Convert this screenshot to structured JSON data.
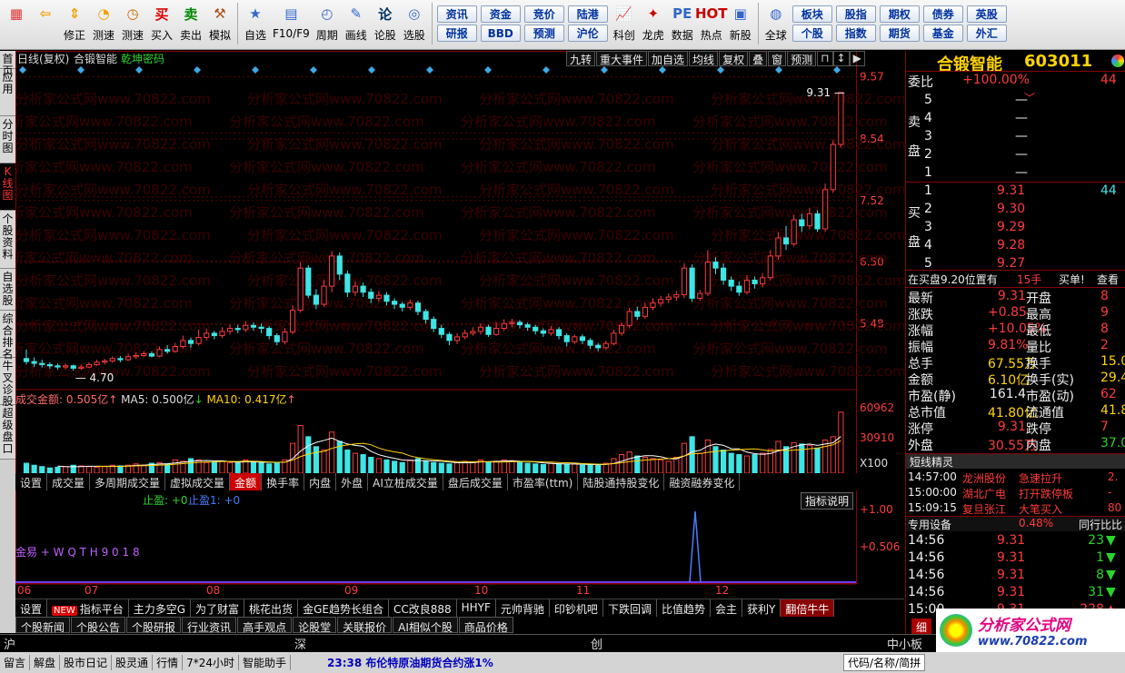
{
  "toolbar": {
    "buttons": [
      {
        "label": "",
        "icon": "grid-icon"
      },
      {
        "label": "",
        "icon": "back-arrow-icon"
      },
      {
        "label": "修正",
        "icon": "up-down-arrows-icon"
      },
      {
        "label": "测速",
        "icon": "speed-icon"
      },
      {
        "label": "测速",
        "icon": "clock-icon"
      },
      {
        "label": "买入",
        "icon": "buy-icon",
        "glyph": "买"
      },
      {
        "label": "卖出",
        "icon": "sell-icon",
        "glyph": "卖"
      },
      {
        "label": "模拟",
        "icon": "hammer-icon"
      },
      {
        "label": "自选",
        "icon": "star-icon"
      },
      {
        "label": "F10/F9",
        "icon": "f10-icon"
      },
      {
        "label": "周期",
        "icon": "period-icon"
      },
      {
        "label": "画线",
        "icon": "pencil-icon"
      },
      {
        "label": "论股",
        "icon": "comment-icon",
        "glyph": "论"
      },
      {
        "label": "选股",
        "icon": "select-stock-icon"
      },
      {
        "label": "科创",
        "icon": "chart-icon"
      },
      {
        "label": "龙虎",
        "icon": "dragon-icon"
      },
      {
        "label": "数据",
        "icon": "pe-icon",
        "glyph": "PE"
      },
      {
        "label": "热点",
        "icon": "hot-icon",
        "glyph": "HOT"
      },
      {
        "label": "新股",
        "icon": "new-stock-icon"
      },
      {
        "label": "全球",
        "icon": "globe-icon"
      }
    ],
    "quick_grid1": [
      [
        "资讯",
        "研报"
      ],
      [
        "资金",
        "BBD"
      ],
      [
        "竞价",
        "预测"
      ],
      [
        "陆港",
        "沪伦"
      ]
    ],
    "quick_grid2": [
      [
        "板块",
        "个股"
      ],
      [
        "股指",
        "指数"
      ],
      [
        "期权",
        "期货"
      ],
      [
        "债券",
        "基金"
      ],
      [
        "英股",
        "外汇"
      ]
    ]
  },
  "left_tabs": [
    "首页",
    "应用",
    "分时图",
    "K线图",
    "个股资料",
    "自选股",
    "综合排名",
    "牛叉诊股",
    "超级盘口"
  ],
  "chart_header": {
    "mode": "日线(复权)",
    "stock_name": "合锻智能",
    "secret": "乾坤密码",
    "buttons": [
      "九转",
      "重大事件",
      "加自选",
      "均线",
      "复权",
      "叠",
      "窗",
      "预测"
    ]
  },
  "volume_header": {
    "label": "成交金额:",
    "value": "0.505亿",
    "ma5_label": "MA5:",
    "ma5": "0.500亿",
    "ma10_label": "MA10:",
    "ma10": "0.417亿"
  },
  "indicator_header": {
    "stop1": "止盈: +0",
    "stop2": "止盈1: +0",
    "explain": "指标说明",
    "code": "金易 + W Q T H 9 0 1 8"
  },
  "chart_data": {
    "type": "candlestick",
    "price_axis": [
      "9.57",
      "8.54",
      "7.52",
      "6.50",
      "5.48"
    ],
    "volume_axis": [
      "60962",
      "30910",
      "X100"
    ],
    "indicator_axis": [
      "+1.00",
      "+0.506"
    ],
    "months": [
      "06",
      "07",
      "08",
      "09",
      "10",
      "11",
      "12"
    ],
    "high_label": "9.31",
    "low_label": "4.70",
    "ylim": [
      4.4,
      9.7
    ],
    "candles": [
      [
        4.9,
        4.85,
        5.05,
        4.8
      ],
      [
        4.85,
        4.82,
        4.92,
        4.76
      ],
      [
        4.82,
        4.8,
        4.88,
        4.75
      ],
      [
        4.8,
        4.78,
        4.84,
        4.73
      ],
      [
        4.78,
        4.76,
        4.82,
        4.72
      ],
      [
        4.76,
        4.78,
        4.82,
        4.72
      ],
      [
        4.78,
        4.74,
        4.8,
        4.7
      ],
      [
        4.74,
        4.76,
        4.8,
        4.71
      ],
      [
        4.76,
        4.8,
        4.84,
        4.74
      ],
      [
        4.8,
        4.84,
        4.88,
        4.78
      ],
      [
        4.84,
        4.86,
        4.9,
        4.8
      ],
      [
        4.86,
        4.9,
        4.94,
        4.83
      ],
      [
        4.9,
        4.88,
        4.94,
        4.84
      ],
      [
        4.88,
        4.93,
        4.98,
        4.86
      ],
      [
        4.93,
        4.95,
        5.0,
        4.9
      ],
      [
        4.95,
        4.98,
        5.02,
        4.92
      ],
      [
        4.98,
        4.94,
        5.02,
        4.92
      ],
      [
        4.94,
        5.05,
        5.1,
        4.92
      ],
      [
        5.05,
        5.02,
        5.12,
        4.98
      ],
      [
        5.02,
        5.1,
        5.16,
        5.0
      ],
      [
        5.1,
        5.2,
        5.28,
        5.06
      ],
      [
        5.2,
        5.15,
        5.25,
        5.08
      ],
      [
        5.15,
        5.25,
        5.38,
        5.12
      ],
      [
        5.25,
        5.32,
        5.4,
        5.2
      ],
      [
        5.32,
        5.28,
        5.36,
        5.22
      ],
      [
        5.28,
        5.35,
        5.42,
        5.24
      ],
      [
        5.35,
        5.4,
        5.46,
        5.3
      ],
      [
        5.4,
        5.38,
        5.46,
        5.32
      ],
      [
        5.38,
        5.45,
        5.52,
        5.34
      ],
      [
        5.45,
        5.42,
        5.5,
        5.36
      ],
      [
        5.42,
        5.4,
        5.48,
        5.32
      ],
      [
        5.4,
        5.28,
        5.44,
        5.22
      ],
      [
        5.28,
        5.18,
        5.32,
        5.12
      ],
      [
        5.18,
        5.34,
        5.4,
        5.14
      ],
      [
        5.34,
        5.7,
        5.78,
        5.3
      ],
      [
        5.7,
        6.4,
        6.5,
        5.66
      ],
      [
        6.4,
        5.95,
        6.45,
        5.9
      ],
      [
        5.95,
        5.8,
        6.05,
        5.72
      ],
      [
        5.8,
        6.1,
        6.2,
        5.76
      ],
      [
        6.1,
        6.6,
        6.68,
        6.0
      ],
      [
        6.6,
        6.3,
        6.66,
        6.2
      ],
      [
        6.3,
        6.0,
        6.36,
        5.92
      ],
      [
        6.0,
        6.1,
        6.18,
        5.94
      ],
      [
        6.1,
        6.0,
        6.16,
        5.92
      ],
      [
        6.0,
        5.9,
        6.06,
        5.82
      ],
      [
        5.9,
        5.95,
        6.02,
        5.84
      ],
      [
        5.95,
        5.85,
        6.0,
        5.78
      ],
      [
        5.85,
        5.8,
        5.9,
        5.72
      ],
      [
        5.8,
        5.75,
        5.84,
        5.68
      ],
      [
        5.75,
        5.82,
        5.88,
        5.7
      ],
      [
        5.82,
        5.68,
        5.86,
        5.62
      ],
      [
        5.68,
        5.55,
        5.72,
        5.48
      ],
      [
        5.55,
        5.4,
        5.6,
        5.34
      ],
      [
        5.4,
        5.3,
        5.46,
        5.24
      ],
      [
        5.3,
        5.2,
        5.34,
        5.12
      ],
      [
        5.2,
        5.26,
        5.32,
        5.14
      ],
      [
        5.26,
        5.32,
        5.38,
        5.22
      ],
      [
        5.32,
        5.35,
        5.42,
        5.28
      ],
      [
        5.35,
        5.42,
        5.48,
        5.3
      ],
      [
        5.42,
        5.3,
        5.46,
        5.26
      ],
      [
        5.3,
        5.4,
        5.5,
        5.28
      ],
      [
        5.4,
        5.48,
        5.55,
        5.36
      ],
      [
        5.48,
        5.5,
        5.56,
        5.42
      ],
      [
        5.5,
        5.46,
        5.54,
        5.4
      ],
      [
        5.46,
        5.42,
        5.5,
        5.36
      ],
      [
        5.42,
        5.36,
        5.46,
        5.3
      ],
      [
        5.36,
        5.32,
        5.4,
        5.26
      ],
      [
        5.32,
        5.38,
        5.44,
        5.28
      ],
      [
        5.38,
        5.28,
        5.42,
        5.22
      ],
      [
        5.28,
        5.18,
        5.32,
        5.1
      ],
      [
        5.18,
        5.26,
        5.3,
        5.14
      ],
      [
        5.26,
        5.2,
        5.3,
        5.14
      ],
      [
        5.2,
        5.12,
        5.24,
        5.06
      ],
      [
        5.12,
        5.08,
        5.16,
        5.02
      ],
      [
        5.08,
        5.15,
        5.2,
        5.04
      ],
      [
        5.15,
        5.32,
        5.38,
        5.12
      ],
      [
        5.32,
        5.45,
        5.5,
        5.28
      ],
      [
        5.45,
        5.68,
        5.74,
        5.4
      ],
      [
        5.68,
        5.6,
        5.76,
        5.54
      ],
      [
        5.6,
        5.75,
        5.82,
        5.56
      ],
      [
        5.75,
        5.82,
        5.9,
        5.7
      ],
      [
        5.82,
        5.88,
        5.94,
        5.76
      ],
      [
        5.88,
        5.92,
        5.98,
        5.82
      ],
      [
        5.92,
        5.96,
        6.02,
        5.86
      ],
      [
        5.96,
        6.4,
        6.48,
        5.9
      ],
      [
        6.4,
        5.9,
        6.46,
        5.84
      ],
      [
        5.9,
        5.98,
        6.04,
        5.86
      ],
      [
        5.98,
        6.5,
        6.7,
        5.94
      ],
      [
        6.5,
        6.4,
        6.58,
        6.3
      ],
      [
        6.4,
        6.2,
        6.48,
        6.12
      ],
      [
        6.2,
        6.1,
        6.26,
        6.02
      ],
      [
        6.1,
        6.0,
        6.18,
        5.94
      ],
      [
        6.0,
        6.2,
        6.28,
        5.96
      ],
      [
        6.2,
        6.14,
        6.26,
        6.06
      ],
      [
        6.14,
        6.24,
        6.32,
        6.08
      ],
      [
        6.24,
        6.6,
        6.7,
        6.2
      ],
      [
        6.6,
        6.9,
        7.0,
        6.54
      ],
      [
        6.9,
        6.8,
        7.1,
        6.7
      ],
      [
        6.8,
        7.2,
        7.28,
        6.76
      ],
      [
        7.2,
        7.1,
        7.3,
        7.0
      ],
      [
        7.1,
        7.3,
        7.4,
        7.04
      ],
      [
        7.3,
        7.05,
        7.36,
        7.0
      ],
      [
        7.05,
        7.7,
        7.8,
        7.0
      ],
      [
        7.7,
        8.45,
        8.52,
        7.65
      ],
      [
        8.45,
        9.31,
        9.31,
        8.4
      ]
    ],
    "volumes": [
      0.15,
      0.12,
      0.1,
      0.08,
      0.09,
      0.1,
      0.12,
      0.11,
      0.1,
      0.09,
      0.1,
      0.12,
      0.11,
      0.12,
      0.14,
      0.12,
      0.15,
      0.16,
      0.14,
      0.2,
      0.18,
      0.22,
      0.2,
      0.16,
      0.17,
      0.18,
      0.16,
      0.15,
      0.2,
      0.17,
      0.16,
      0.14,
      0.15,
      0.2,
      0.45,
      0.72,
      0.55,
      0.4,
      0.35,
      0.62,
      0.48,
      0.35,
      0.3,
      0.28,
      0.24,
      0.22,
      0.2,
      0.18,
      0.16,
      0.2,
      0.22,
      0.18,
      0.16,
      0.15,
      0.14,
      0.16,
      0.18,
      0.17,
      0.2,
      0.16,
      0.18,
      0.2,
      0.19,
      0.17,
      0.15,
      0.14,
      0.13,
      0.15,
      0.14,
      0.13,
      0.14,
      0.12,
      0.13,
      0.12,
      0.15,
      0.22,
      0.28,
      0.32,
      0.26,
      0.24,
      0.22,
      0.2,
      0.18,
      0.24,
      0.45,
      0.55,
      0.3,
      0.5,
      0.4,
      0.35,
      0.3,
      0.28,
      0.26,
      0.28,
      0.3,
      0.36,
      0.48,
      0.4,
      0.46,
      0.44,
      0.42,
      0.38,
      0.5,
      0.55,
      0.92
    ],
    "signal": [
      0,
      0,
      0,
      0,
      0,
      0,
      0,
      0,
      0,
      0,
      0,
      0,
      0,
      0,
      0,
      0,
      0,
      0,
      0,
      0,
      0,
      0,
      0,
      0,
      0,
      0,
      0,
      0,
      0,
      0,
      0,
      0,
      0,
      0,
      0,
      0,
      0,
      0,
      0,
      0,
      0,
      0,
      0,
      0,
      0,
      0,
      0,
      0,
      0,
      0,
      0,
      0,
      0,
      0,
      0,
      0,
      0,
      0,
      0,
      0,
      0,
      0,
      0,
      0,
      0,
      0,
      0,
      0,
      0,
      0,
      0,
      0,
      0,
      0,
      0,
      0,
      0,
      0,
      0,
      0,
      0,
      0,
      0,
      0,
      0,
      0,
      0,
      0,
      0,
      0,
      0,
      0,
      0,
      0,
      0,
      0,
      0,
      0,
      0,
      0,
      0,
      0,
      0,
      0,
      0,
      0,
      0,
      1,
      0,
      0,
      0,
      0,
      0,
      0,
      0,
      0,
      0,
      0,
      0,
      0,
      0,
      0,
      0,
      0,
      0,
      0
    ]
  },
  "volume_tabs": [
    "设置",
    "成交量",
    "多周期成交量",
    "虚拟成交量",
    "金额",
    "换手率",
    "内盘",
    "外盘",
    "AI立桩成交量",
    "盘后成交量",
    "市盈率(ttm)",
    "陆股通持股变化",
    "融资融券变化"
  ],
  "indicator_tabs": [
    "设置",
    "指标平台",
    "主力多空G",
    "为了财富",
    "桃花出货",
    "金GE趋势长组合",
    "CC改良888",
    "HHYF",
    "元帅背驰",
    "印钞机吧",
    "下跌回调",
    "比值趋势",
    "会主",
    "获利Y",
    "翻倍牛牛"
  ],
  "new_badge": "NEW",
  "news_tabs": [
    "个股新闻",
    "个股公告",
    "个股研报",
    "行业资讯",
    "高手观点",
    "论股堂",
    "关联报价",
    "AI相似个股",
    "商品价格"
  ],
  "quote": {
    "name": "合锻智能",
    "code": "603011",
    "weibi_label": "委比",
    "weibi": "+100.00%",
    "weicha": "44",
    "sell_label": [
      "卖",
      "盘"
    ],
    "buy_label": [
      "买",
      "盘"
    ],
    "sell": [
      [
        "5",
        "",
        "—"
      ],
      [
        "4",
        "",
        "—"
      ],
      [
        "3",
        "",
        "—"
      ],
      [
        "2",
        "",
        "—"
      ],
      [
        "1",
        "",
        "—"
      ]
    ],
    "buy": [
      [
        "1",
        "9.31",
        "44"
      ],
      [
        "2",
        "9.30",
        ""
      ],
      [
        "3",
        "9.29",
        ""
      ],
      [
        "4",
        "9.28",
        ""
      ],
      [
        "5",
        "9.27",
        ""
      ]
    ],
    "notice": "在买盘9.20位置有",
    "notice_qty": "15手",
    "notice_action": "买单!",
    "notice_view": "查看",
    "stats": [
      [
        "最新",
        "9.31",
        "开盘",
        "8"
      ],
      [
        "涨跌",
        "+0.85",
        "最高",
        "9"
      ],
      [
        "涨幅",
        "+10.05%",
        "最低",
        "8"
      ],
      [
        "振幅",
        "9.81%",
        "量比",
        "2"
      ],
      [
        "总手",
        "67.55万",
        "换手",
        "15.0"
      ],
      [
        "金额",
        "6.10亿",
        "换手(实)",
        "29.4"
      ],
      [
        "市盈(静)",
        "161.4",
        "市盈(动)",
        "62"
      ],
      [
        "总市值",
        "41.80亿",
        "流通值",
        "41.8"
      ],
      [
        "涨停",
        "9.31",
        "跌停",
        "7"
      ],
      [
        "外盘",
        "30.55万",
        "内盘",
        "37.0"
      ]
    ],
    "shortline_title": "短线精灵",
    "shortline": [
      [
        "14:57:00",
        "龙洲股份",
        "急速拉升",
        "2."
      ],
      [
        "15:00:00",
        "湖北广电",
        "打开跌停板",
        "-"
      ],
      [
        "15:09:15",
        "复旦张江",
        "大笔买入",
        "80"
      ]
    ],
    "ticks_title": "专用设备",
    "ticks_pct": "0.48%",
    "ticks_right": "同行比比",
    "ticks": [
      [
        "14:56",
        "9.31",
        "23"
      ],
      [
        "14:56",
        "9.31",
        "1"
      ],
      [
        "14:56",
        "9.31",
        "8"
      ],
      [
        "14:56",
        "9.31",
        "31"
      ],
      [
        "15:00",
        "9.31",
        "228"
      ]
    ],
    "xi_tab": "细"
  },
  "index_bar": {
    "sh": "沪",
    "sz": "深",
    "cy": "创",
    "zx": "中小板"
  },
  "status_bar": {
    "items": [
      "留言",
      "解盘",
      "股市日记",
      "股灵通",
      "行情",
      "7*24小时",
      "智能助手"
    ],
    "ticker": "23:38 布伦特原油期货合约涨1%",
    "right": "代码/名称/简拼"
  },
  "watermark": "分析家公式网www.70822.com",
  "brand": {
    "name": "分析家公式网",
    "url": "www.70822.com"
  }
}
